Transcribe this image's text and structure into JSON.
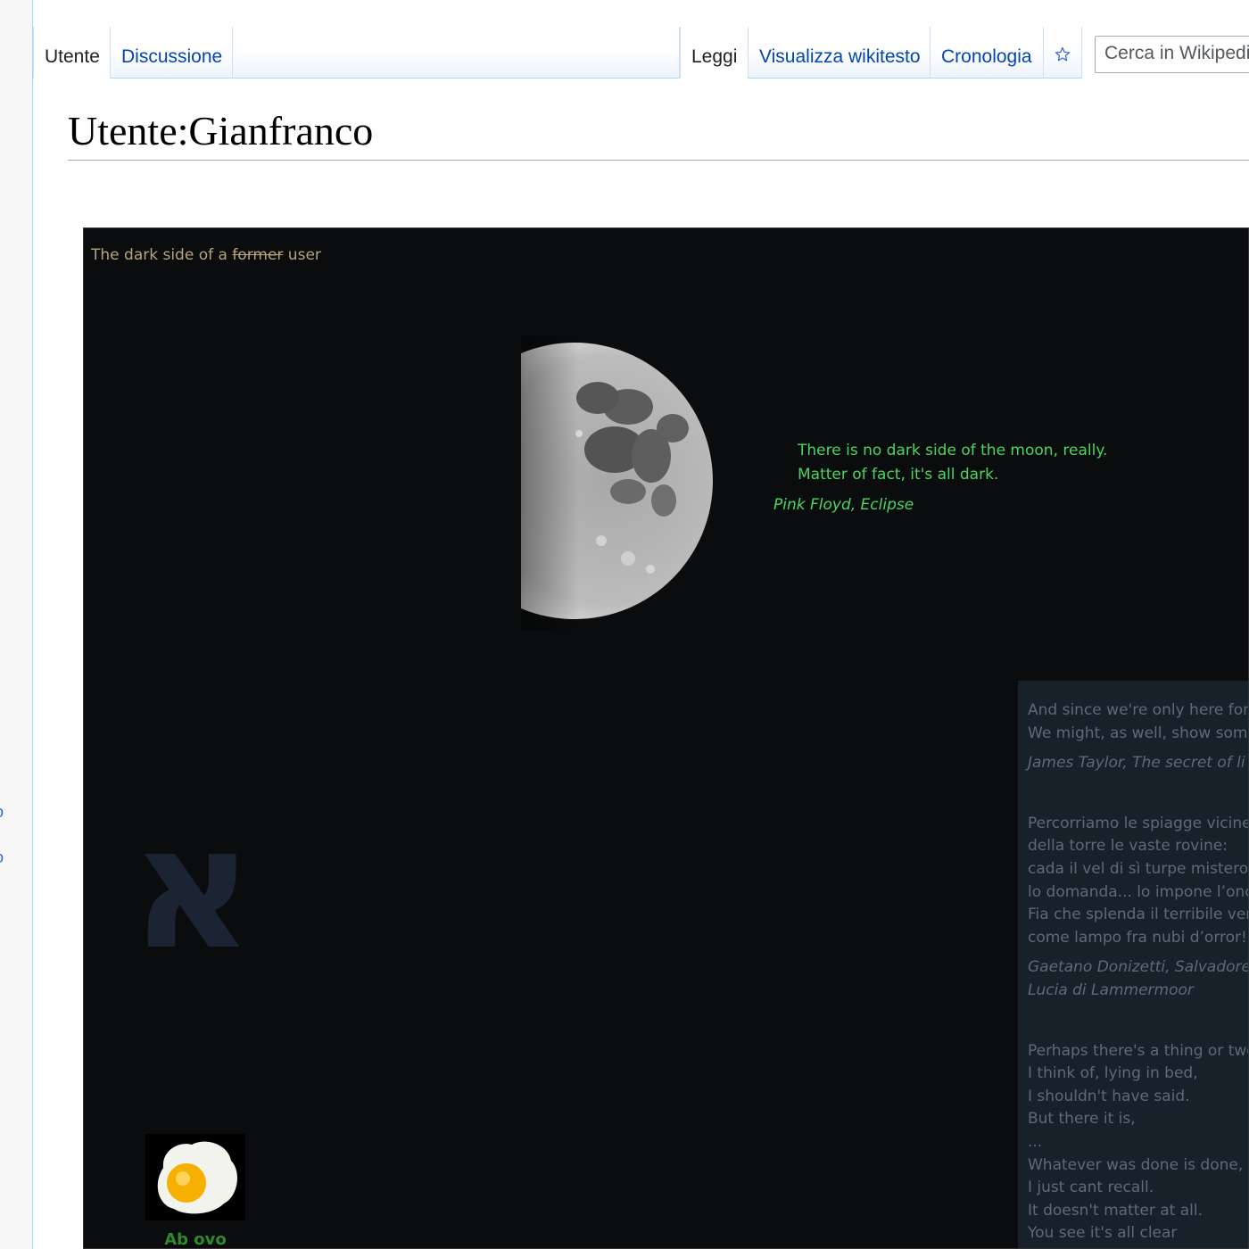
{
  "tabs": {
    "left": [
      {
        "label": "Utente",
        "selected": true
      },
      {
        "label": "Discussione",
        "selected": false
      }
    ],
    "right": [
      {
        "label": "Leggi",
        "selected": true
      },
      {
        "label": "Visualizza wikitesto",
        "selected": false
      },
      {
        "label": "Cronologia",
        "selected": false
      }
    ],
    "watch_icon": "star-icon"
  },
  "search": {
    "placeholder": "Cerca in Wikipedia"
  },
  "page": {
    "title": "Utente:Gianfranco"
  },
  "panel": {
    "caption_before": "The dark side of a ",
    "caption_struck": "former",
    "caption_after": " user",
    "quote_line_1": "There is no dark side of the moon, really.",
    "quote_line_2": "Matter of fact, it's all dark.",
    "quote_credit": "Pink Floyd, Eclipse",
    "aleph": "א",
    "egg_label": "Ab ovo",
    "side": {
      "q1_l1": "And since we're only here for",
      "q1_l2": "We might, as well, show som",
      "q1_credit": "James Taylor, The secret of li",
      "q2_l1": "Percorriamo le spiagge vicine",
      "q2_l2": "della torre le vaste rovine:",
      "q2_l3": "cada il vel di sì turpe mistero",
      "q2_l4": "lo domanda... lo impone l’onc",
      "q2_l5": "Fia che splenda il terribile ver",
      "q2_l6": "come lampo fra nubi d’orror!",
      "q2_credit_1": "Gaetano Donizetti, Salvadore",
      "q2_credit_2": "Lucia di Lammermoor",
      "q3_l1": "Perhaps there's a thing or two",
      "q3_l2": "I think of, lying in bed,",
      "q3_l3": "I shouldn't have said.",
      "q3_l4": "But there it is,",
      "q3_l5": "...",
      "q3_l6": "Whatever was done is done,",
      "q3_l7": "I just cant recall.",
      "q3_l8": "It doesn't matter at all.",
      "q3_l9": "You see it's all clear"
    }
  },
  "colors": {
    "link": "#0645ad",
    "panel_bg": "#0a0c0d",
    "quote_green": "#49d661",
    "side_box_bg": "#18202a"
  }
}
